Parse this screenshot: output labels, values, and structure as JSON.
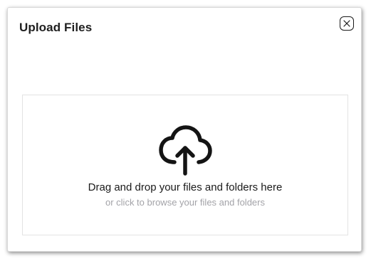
{
  "dialog": {
    "title": "Upload Files",
    "close_icon": "close-icon"
  },
  "drop_zone": {
    "icon": "cloud-upload-icon",
    "primary_text": "Drag and drop your files and folders here",
    "secondary_text": "or click to browse your files and folders"
  },
  "colors": {
    "title_text": "#1f1f1f",
    "secondary_text": "#a3a3a8",
    "border": "#e3e3e3"
  }
}
